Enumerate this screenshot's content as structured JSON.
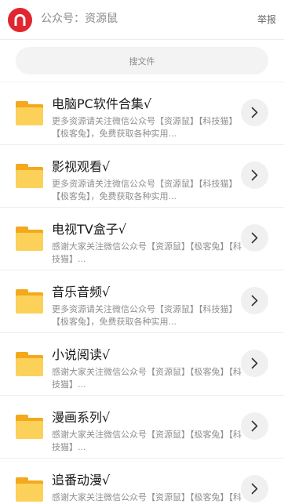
{
  "header": {
    "account": "公众号：资源鼠",
    "report_label": "举报",
    "logo_icon": "magnet-icon",
    "logo_color": "#e0262f"
  },
  "search": {
    "label": "搜文件"
  },
  "items": [
    {
      "title": "电脑PC软件合集√",
      "desc": "更多资源请关注微信公众号【资源鼠】【科技猫】【极客兔】，免费获取各种实用..."
    },
    {
      "title": "影视观看√",
      "desc": "更多资源请关注微信公众号【资源鼠】【科技猫】【极客兔】，免费获取各种实用..."
    },
    {
      "title": "电视TV盒子√",
      "desc": "感谢大家关注微信公众号【资源鼠】【极客兔】【科技猫】..."
    },
    {
      "title": "音乐音频√",
      "desc": "更多资源请关注微信公众号【资源鼠】【科技猫】【极客兔】，免费获取各种实用..."
    },
    {
      "title": "小说阅读√",
      "desc": "感谢大家关注微信公众号【资源鼠】【极客兔】【科技猫】..."
    },
    {
      "title": "漫画系列√",
      "desc": "感谢大家关注微信公众号【资源鼠】【极客兔】【科技猫】..."
    },
    {
      "title": "追番动漫√",
      "desc": "感谢大家关注微信公众号【资源鼠】【极客兔】【科技猫】..."
    }
  ],
  "colors": {
    "folder_back": "#f3a91c",
    "folder_front": "#fcd15a",
    "arrow_bg": "#f0f0f0"
  }
}
